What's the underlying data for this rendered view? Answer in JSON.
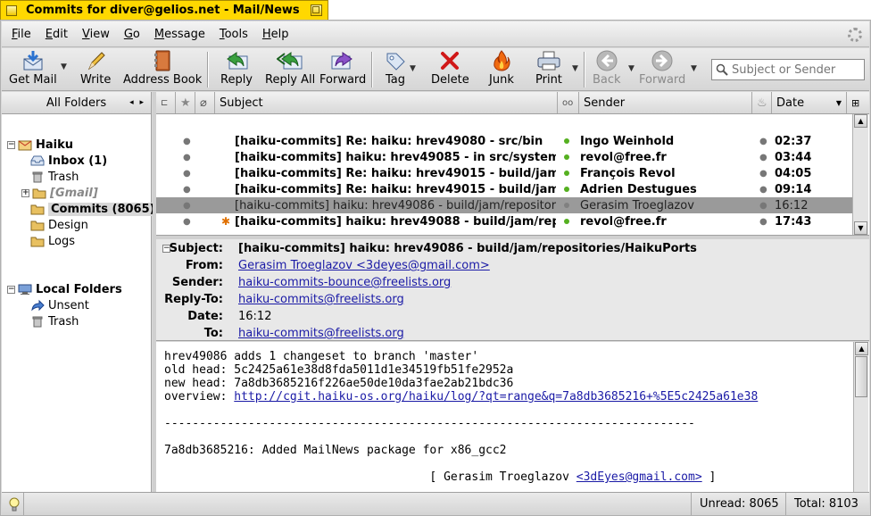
{
  "window": {
    "title": "Commits for diver@gelios.net - Mail/News"
  },
  "menu": [
    {
      "label": "File",
      "key": "F",
      "rest": "ile"
    },
    {
      "label": "Edit",
      "key": "E",
      "rest": "dit"
    },
    {
      "label": "View",
      "key": "V",
      "rest": "iew"
    },
    {
      "label": "Go",
      "key": "G",
      "rest": "o"
    },
    {
      "label": "Message",
      "key": "M",
      "rest": "essage"
    },
    {
      "label": "Tools",
      "key": "T",
      "rest": "ools"
    },
    {
      "label": "Help",
      "key": "H",
      "rest": "elp"
    }
  ],
  "toolbar": {
    "get_mail": "Get Mail",
    "write": "Write",
    "address_book": "Address Book",
    "reply": "Reply",
    "reply_all": "Reply All",
    "forward": "Forward",
    "tag": "Tag",
    "delete": "Delete",
    "junk": "Junk",
    "print": "Print",
    "back": "Back",
    "forward_nav": "Forward",
    "search_placeholder": "Subject or Sender"
  },
  "folders": {
    "header": "All Folders",
    "account1": "Haiku",
    "inbox": "Inbox (1)",
    "trash": "Trash",
    "gmail": "[Gmail]",
    "commits": "Commits (8065)",
    "design": "Design",
    "logs": "Logs",
    "local": "Local Folders",
    "unsent": "Unsent",
    "local_trash": "Trash"
  },
  "columns": {
    "subject": "Subject",
    "sender": "Sender",
    "date": "Date"
  },
  "messages": [
    {
      "subject": "[haiku-commits] Re: haiku: hrev49080 - src/bin",
      "sender": "Ingo Weinhold",
      "date": "02:37"
    },
    {
      "subject": "[haiku-commits] haiku: hrev49085 - in src/system...",
      "sender": "revol@free.fr",
      "date": "03:44"
    },
    {
      "subject": "[haiku-commits] Re: haiku: hrev49015 - build/jam/...",
      "sender": "François Revol",
      "date": "04:05"
    },
    {
      "subject": "[haiku-commits] Re: haiku: hrev49015 - build/jam/...",
      "sender": "Adrien Destugues",
      "date": "09:14"
    },
    {
      "subject": "[haiku-commits] haiku: hrev49086 - build/jam/repositori...",
      "sender": "Gerasim Troeglazov",
      "date": "16:12"
    },
    {
      "subject": "[haiku-commits] haiku: hrev49088 - build/jam/rep...",
      "sender": "revol@free.fr",
      "date": "17:43"
    }
  ],
  "header": {
    "subject_label": "Subject:",
    "subject": "[haiku-commits] haiku: hrev49086 - build/jam/repositories/HaikuPorts",
    "from_label": "From:",
    "from": "Gerasim Troeglazov <3deyes@gmail.com>",
    "sender_label": "Sender:",
    "sender": "haiku-commits-bounce@freelists.org",
    "replyto_label": "Reply-To:",
    "replyto": "haiku-commits@freelists.org",
    "date_label": "Date:",
    "date": "16:12",
    "to_label": "To:",
    "to": "haiku-commits@freelists.org"
  },
  "body": {
    "l1": "hrev49086 adds 1 changeset to branch 'master'",
    "l2": "old head: 5c2425a61e38d8fda5011d1e34519fb51fe2952a",
    "l3": "new head: 7a8db3685216f226ae50de10da3fae2ab21bdc36",
    "l4_label": "overview: ",
    "l4_link": "http://cgit.haiku-os.org/haiku/log/?qt=range&q=7a8db3685216+%5E5c2425a61e38",
    "rule": "----------------------------------------------------------------------------",
    "l5": "7a8db3685216: Added MailNews package for x86_gcc2",
    "l6_pre": "                                      [ Gerasim Troeglazov ",
    "l6_link": "<3dEyes@gmail.com>",
    "l6_post": " ]"
  },
  "status": {
    "unread": "Unread: 8065",
    "total": "Total: 8103"
  }
}
